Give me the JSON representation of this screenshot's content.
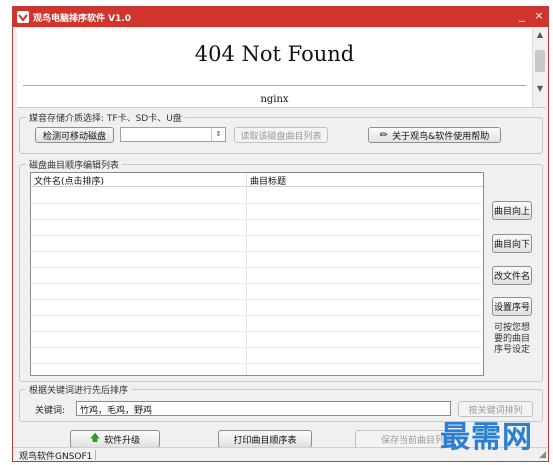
{
  "window": {
    "title": "观鸟电脑排序软件 V1.0",
    "minimize_glyph": "_",
    "close_glyph": "×"
  },
  "webview": {
    "heading": "404 Not Found",
    "server": "nginx"
  },
  "storage_group": {
    "legend": "媒音存储介质选择: TF卡、SD卡、U盘",
    "detect_button": "检测可移动磁盘",
    "drive_select_value": "",
    "read_button": "读取该磁盘曲目列表",
    "help_button": "关于观鸟&软件使用帮助"
  },
  "order_group": {
    "legend": "磁盘曲目顺序编辑列表",
    "columns": [
      "文件名(点击排序)",
      "曲目标题"
    ],
    "rows": [],
    "move_up_button": "曲目向上",
    "move_down_button": "曲目向下",
    "rename_button": "改文件名",
    "set_number_button": "设置序号",
    "hint_lines": [
      "可按您想",
      "要的曲目",
      "序号设定"
    ]
  },
  "keyword_group": {
    "legend": "根据关键词进行先后排序",
    "keyword_label": "关键词:",
    "keyword_value": "竹鸡，毛鸡，野鸡",
    "sort_button": "按关键词排列"
  },
  "bottom": {
    "upgrade_button": "软件升级",
    "print_button": "打印曲目顺序表",
    "save_button": "保存当前曲目列表"
  },
  "status": {
    "text": "观鸟软件GNSOF1"
  },
  "watermark": {
    "text": "最需网"
  },
  "colors": {
    "titlebar": "#d0342c",
    "watermark": "#2a7fd0",
    "upgrade_arrow": "#2a9a2a"
  }
}
